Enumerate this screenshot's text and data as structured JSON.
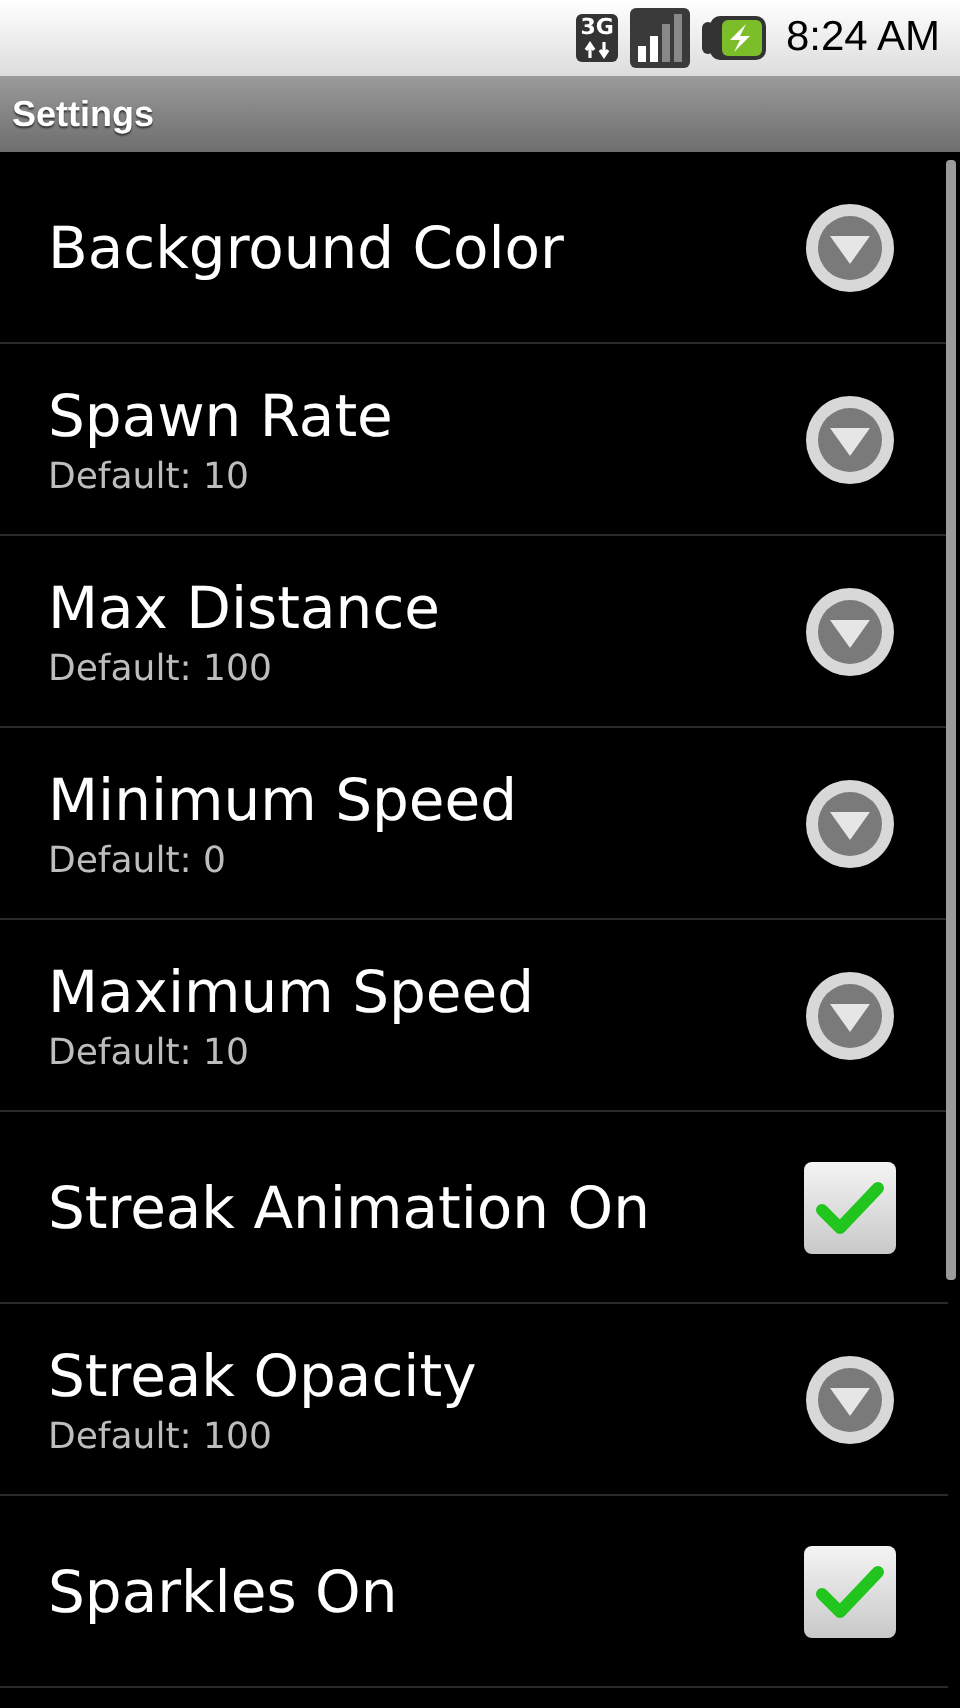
{
  "status_bar": {
    "network": "3G",
    "time": "8:24 AM"
  },
  "title_bar": {
    "title": "Settings"
  },
  "settings": [
    {
      "kind": "list",
      "title": "Background Color"
    },
    {
      "kind": "list",
      "title": "Spawn Rate",
      "summary": "Default: 10"
    },
    {
      "kind": "list",
      "title": "Max Distance",
      "summary": "Default: 100"
    },
    {
      "kind": "list",
      "title": "Minimum Speed",
      "summary": "Default: 0"
    },
    {
      "kind": "list",
      "title": "Maximum Speed",
      "summary": "Default: 10"
    },
    {
      "kind": "checkbox",
      "title": "Streak Animation On",
      "checked": true
    },
    {
      "kind": "list",
      "title": "Streak Opacity",
      "summary": "Default: 100"
    },
    {
      "kind": "checkbox",
      "title": "Sparkles On",
      "checked": true
    }
  ]
}
